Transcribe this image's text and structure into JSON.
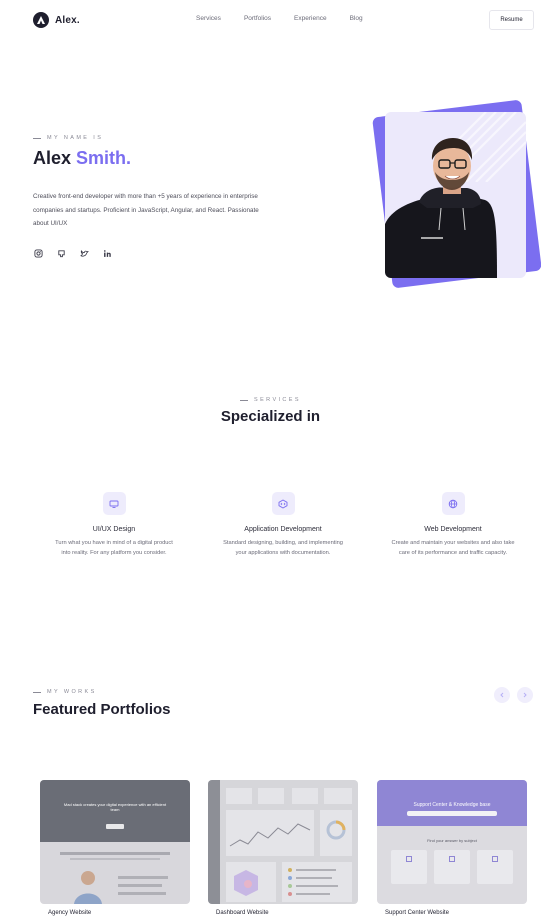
{
  "nav": {
    "logo_text": "Alex.",
    "links": [
      "Services",
      "Portfolios",
      "Experience",
      "Blog"
    ],
    "resume_label": "Resume"
  },
  "hero": {
    "eyebrow": "MY NAME IS",
    "first_name": "Alex",
    "last_name": "Smith.",
    "description": "Creative front-end developer with more than +5 years of experience in enterprise companies and startups. Proficient in JavaScript, Angular, and React. Passionate about UI/UX",
    "socials": [
      "instagram-icon",
      "github-icon",
      "twitter-icon",
      "linkedin-icon"
    ]
  },
  "services": {
    "eyebrow": "SERVICES",
    "title": "Specialized in",
    "items": [
      {
        "title": "UI/UX Design",
        "desc": "Turn what you have in mind of a digital product into reality. For any platform you consider.",
        "icon": "monitor-icon"
      },
      {
        "title": "Application Development",
        "desc": "Standard designing, building, and implementing your applications with documentation.",
        "icon": "code-icon"
      },
      {
        "title": "Web Development",
        "desc": "Create and maintain your websites and also take care of its performance and traffic capacity.",
        "icon": "globe-icon"
      }
    ]
  },
  "works": {
    "eyebrow": "MY WORKS",
    "title": "Featured Portfolios",
    "cards": [
      {
        "label": "Agency Website"
      },
      {
        "label": "Dashboard Website"
      },
      {
        "label": "Support Center Website"
      }
    ],
    "card1_heading": "Mad stack creates your digital experience with an efficient team",
    "card3_heading": "Support Center & Knowledge base",
    "card3_sub": "Find your answer by subject"
  },
  "colors": {
    "accent": "#7b6ef0",
    "dark": "#1f1f2e",
    "icon_bg": "#eeecfc"
  }
}
